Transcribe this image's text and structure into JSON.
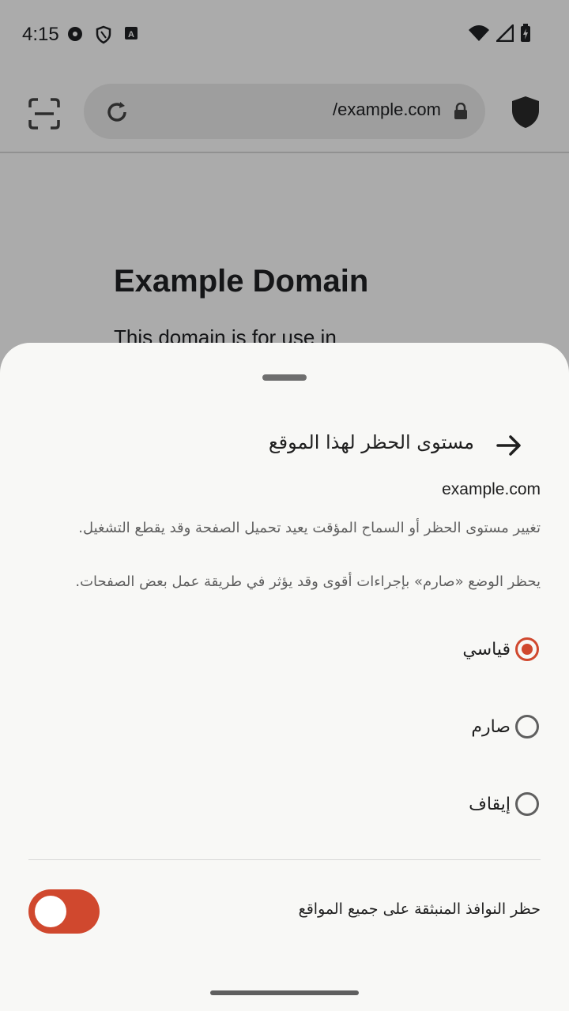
{
  "status_bar": {
    "time": "4:15",
    "icons": [
      "media-icon",
      "vpn-shield-icon",
      "keyboard-a-icon",
      "wifi-icon",
      "signal-icon",
      "battery-charging-icon"
    ]
  },
  "browser": {
    "url": "/example.com",
    "icons": [
      "scan-icon",
      "reload-icon",
      "lock-icon",
      "shield-icon"
    ]
  },
  "page": {
    "title": "Example Domain",
    "text": "This domain is for use in"
  },
  "sheet": {
    "title": "مستوى الحظر لهذا الموقع",
    "domain": "example.com",
    "description_1": "تغيير مستوى الحظر أو السماح المؤقت يعيد تحميل الصفحة وقد يقطع التشغيل.",
    "description_2": "يحظر الوضع «صارم» بإجراءات أقوى وقد يؤثر في طريقة عمل بعض الصفحات.",
    "options": [
      {
        "label": "قياسي",
        "selected": true
      },
      {
        "label": "صارم",
        "selected": false
      },
      {
        "label": "إيقاف",
        "selected": false
      }
    ],
    "popup_toggle": {
      "label": "حظر النوافذ المنبثقة على جميع المواقع",
      "enabled": true
    },
    "accent_color": "#d0482e"
  }
}
